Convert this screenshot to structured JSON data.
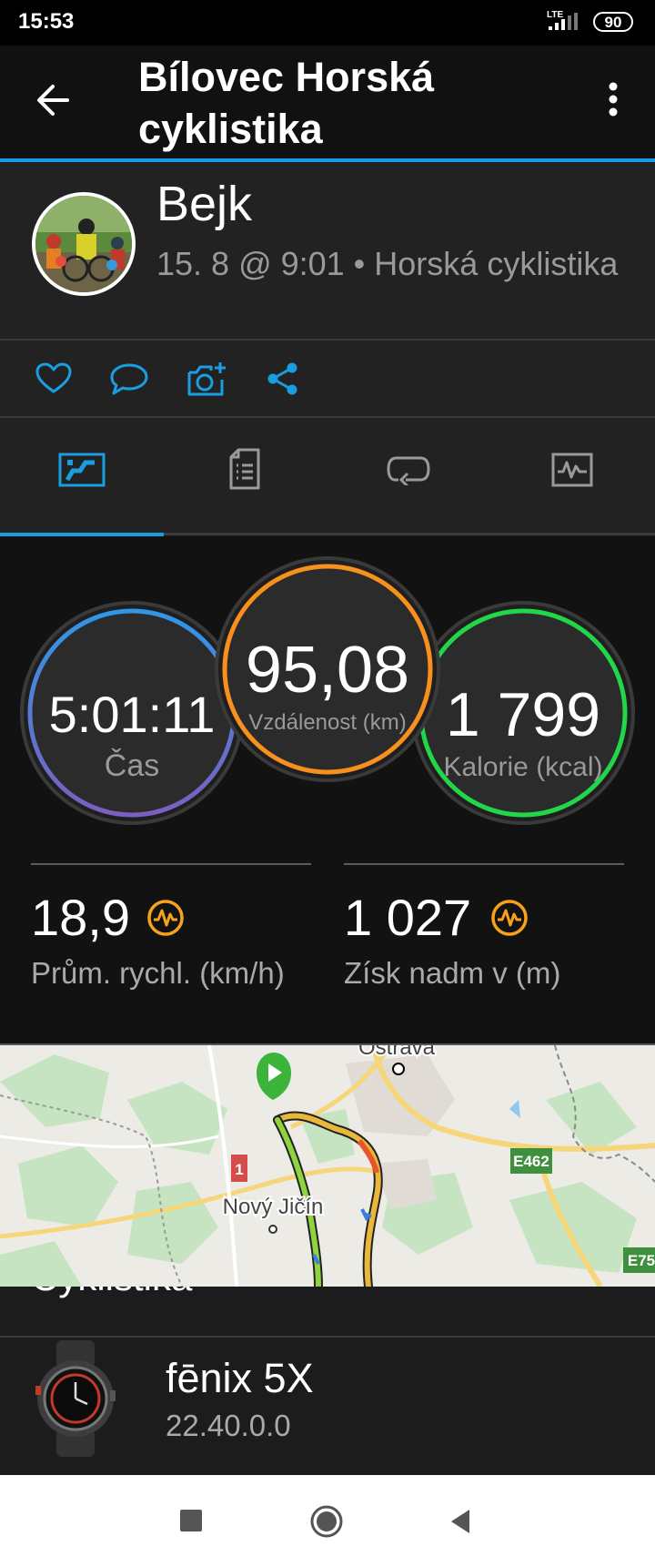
{
  "status_bar": {
    "time": "15:53",
    "network": "LTE",
    "battery": "90"
  },
  "app_bar": {
    "title": "Bílovec Horská cyklistika"
  },
  "profile": {
    "name": "Bejk",
    "subtitle": "15. 8 @ 9:01 • Horská cyklistika"
  },
  "actions": [
    "like-icon",
    "comment-icon",
    "add-photo-icon",
    "share-icon"
  ],
  "tabs": [
    {
      "icon": "overview-icon",
      "selected": true
    },
    {
      "icon": "details-icon",
      "selected": false
    },
    {
      "icon": "laps-icon",
      "selected": false
    },
    {
      "icon": "charts-icon",
      "selected": false
    }
  ],
  "stats": {
    "time": {
      "value": "5:01:11",
      "label": "Čas"
    },
    "distance": {
      "value": "95,08",
      "label": "Vzdálenost (km)"
    },
    "calories": {
      "value": "1 799",
      "label": "Kalorie (kcal)"
    },
    "avg_speed": {
      "value": "18,9",
      "label": "Prům. rychl. (km/h)"
    },
    "elevation": {
      "value": "1 027",
      "label": "Získ nadm v (m)"
    }
  },
  "map": {
    "labels": {
      "city_top": "Ostrava",
      "city": "Nový Jičín",
      "road_e462": "E462",
      "road_e75": "E75",
      "road_1": "1"
    }
  },
  "section_cut_label": "Cyklistika",
  "device": {
    "name": "fēnix 5X",
    "version": "22.40.0.0"
  },
  "colors": {
    "accent": "#1a9ee2",
    "time_ring": "#3a8ee0",
    "distance_ring": "#f7901e",
    "calories_ring": "#22d64a",
    "trend_icon": "#f7a21b"
  }
}
